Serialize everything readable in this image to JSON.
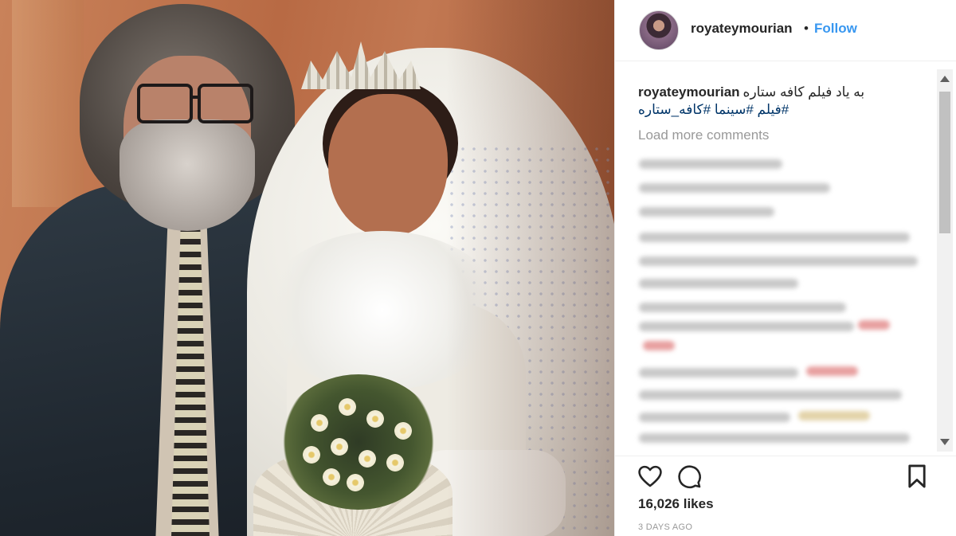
{
  "post": {
    "username": "royateymourian",
    "dot": "•",
    "follow_label": "Follow",
    "caption_user": "royateymourian",
    "caption_text": "به یاد فیلم کافه ستاره",
    "hashtags": "#فیلم #سینما #کافه_ستاره",
    "load_more": "Load more comments",
    "likes": "16,026 likes",
    "time": "3 DAYS AGO"
  },
  "icons": {
    "like": "heart-icon",
    "comment": "comment-bubble-icon",
    "save": "bookmark-icon"
  },
  "colors": {
    "link": "#3897f0",
    "hashtag": "#003569",
    "muted": "#999999",
    "text": "#262626"
  }
}
